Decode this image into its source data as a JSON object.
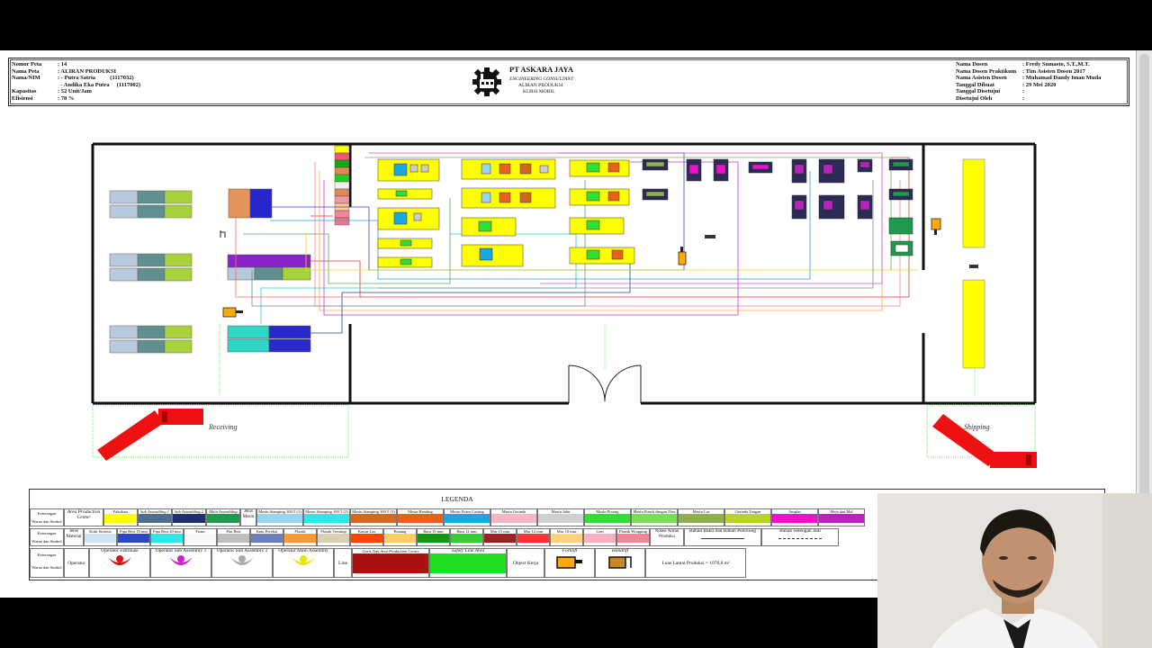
{
  "header_left": {
    "rows": [
      {
        "k": "Nomor Peta",
        "v": ": 14"
      },
      {
        "k": "Nama Peta",
        "v": ": ALIRAN PRODUKSI"
      },
      {
        "k": "Nama/NIM",
        "v": ": - Putra Satria          (1117032)"
      },
      {
        "k": "",
        "v": "  - Andika Eka Putra     (1117002)"
      },
      {
        "k": "Kapasitas",
        "v": ": 52 Unit/Jam"
      },
      {
        "k": "Efisiensi",
        "v": ": 78 %"
      }
    ]
  },
  "header_center": {
    "company": "PT ASKARA JAYA",
    "consultant": "ENGINEERING CONSULTANT",
    "map": "ALIRAN PRODUKSI",
    "product": "KURSI MOBIL"
  },
  "header_right": {
    "rows": [
      {
        "k": "Nama Dosen",
        "v": ": Fredy Sumasto, S.T.,M.T."
      },
      {
        "k": "Nama Dosen Praktikum",
        "v": ": Tim Asisten Dosen 2017"
      },
      {
        "k": "Nama Asisten Dosen",
        "v": ": Muhamad Dandy Iman Muda"
      },
      {
        "k": "Tanggal Dibuat",
        "v": ": 29 Mei 2020"
      },
      {
        "k": "Tanggal Disetujui",
        "v": ":"
      },
      {
        "k": "Disetujui Oleh",
        "v": ":"
      }
    ]
  },
  "labels": {
    "receiving": "Receiving",
    "shipping": "Shipping"
  },
  "legend": {
    "title": "LEGENDA",
    "row1_label": "Keterangan",
    "row1_sub": "Warna dan Simbol",
    "area_production": "Area Production Center",
    "areas": [
      {
        "name": "Fabrikasi",
        "color": "#ffff00"
      },
      {
        "name": "Sub Assembling 1",
        "color": "#4f6d8f"
      },
      {
        "name": "Sub Assembling 2",
        "color": "#1f2f6f"
      },
      {
        "name": "Main Assembling",
        "color": "#1e9a4c"
      }
    ],
    "jenis_mesin": "Jenis Mesin",
    "machines": [
      {
        "name": "Mesin Stamping 100 T (1)",
        "color": "#9ad5f0"
      },
      {
        "name": "Mesin Stamping 100 T (2)",
        "color": "#2fe6e6"
      },
      {
        "name": "Mesin Stamping 100 T (3)",
        "color": "#d2691e"
      },
      {
        "name": "Mesin Bending",
        "color": "#e8601c"
      },
      {
        "name": "Mesin Foam Casting",
        "color": "#19a8e0"
      },
      {
        "name": "Mesin Gerinda",
        "color": "#f5b6c8"
      },
      {
        "name": "Mesin Jahit",
        "color": "#cfcfcf"
      },
      {
        "name": "Mesin Potong",
        "color": "#33dd33"
      },
      {
        "name": "Mesin Punch dengan Dies",
        "color": "#77dd55"
      },
      {
        "name": "Mesin Las",
        "color": "#8fb04f"
      },
      {
        "name": "Gerinda Tangan",
        "color": "#b8d22a"
      },
      {
        "name": "Amplas",
        "color": "#ee11cc"
      },
      {
        "name": "Meja dan Mal",
        "color": "#bb22bb"
      }
    ],
    "jenis_material": "Jenis Material",
    "materials": [
      {
        "name": "Kulit Sintesis",
        "color": "#cfe6f5"
      },
      {
        "name": "Pipa Besi 18 mm",
        "color": "#2a48c8"
      },
      {
        "name": "Pipa Besi 20 mm",
        "color": "#2fe6e6"
      },
      {
        "name": "Foam",
        "color": "#f7f7f7"
      },
      {
        "name": "Plat Besi",
        "color": "#bdbdbd"
      },
      {
        "name": "Kain Perekat",
        "color": "#6e7fbf"
      },
      {
        "name": "Plastik",
        "color": "#ff9933"
      },
      {
        "name": "Plastik Tertutup",
        "color": "#d9d0b0"
      },
      {
        "name": "Kawat Las",
        "color": "#ff4400"
      },
      {
        "name": "Benang",
        "color": "#ffcc66"
      },
      {
        "name": "Baut 15 mm",
        "color": "#119911"
      },
      {
        "name": "Baut 12 mm",
        "color": "#33cc33"
      },
      {
        "name": "Mur 15 mm",
        "color": "#992222"
      },
      {
        "name": "Mur 12 mm",
        "color": "#ff3333"
      },
      {
        "name": "Mur 10 mm",
        "color": "#ffd27f"
      },
      {
        "name": "Lem",
        "color": "#ffb0c0"
      },
      {
        "name": "Plastik Wrapping",
        "color": "#ee8899"
      }
    ],
    "notasi": "Notasi Aliran Produksi",
    "bahan_baku": "Bahan Baku dan Bahan Penolong",
    "bahan_setengah": "Bahan Setengah Jadi",
    "operator_label": "Operator",
    "operators": [
      {
        "name": "Operator Fabrikasi",
        "color": "#dd1111"
      },
      {
        "name": "Operator Sub Assembly 1",
        "color": "#cc22cc"
      },
      {
        "name": "Operator Sub Assembly 2",
        "color": "#aaaaaa"
      },
      {
        "name": "Operator Main Assembly",
        "color": "#e6e600"
      }
    ],
    "line": "Line",
    "garis_tepi": "Garis Tepi Area Production Center",
    "safety_line": "Safety Line Area",
    "object_kerja": "Object Kerja",
    "forklift": "Forklift",
    "handlift": "Handlift",
    "luas": "Luas Lantai Produksi = 1076,8 m²"
  }
}
